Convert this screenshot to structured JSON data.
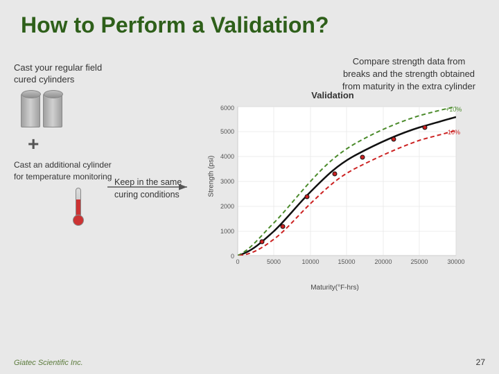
{
  "title": "How to Perform a Validation?",
  "left": {
    "cast_label": "Cast your regular field cured cylinders",
    "plus": "+",
    "extra_label": "Cast an additional cylinder for temperature monitoring"
  },
  "keep_label": "Keep in the same curing conditions",
  "compare_text": "Compare strength data from breaks and the strength obtained from maturity in the extra cylinder",
  "chart": {
    "title": "Validation",
    "y_label": "Strength (psi)",
    "x_label": "Maturity(°F-hrs)",
    "y_ticks": [
      "0",
      "1000",
      "2000",
      "3000",
      "4000",
      "5000",
      "6000"
    ],
    "x_ticks": [
      "0",
      "5000",
      "10000",
      "15000",
      "20000",
      "25000",
      "30000"
    ],
    "annotations": [
      "+10%",
      "-10%"
    ]
  },
  "footer": "Giatec Scientific Inc.",
  "page_number": "27"
}
